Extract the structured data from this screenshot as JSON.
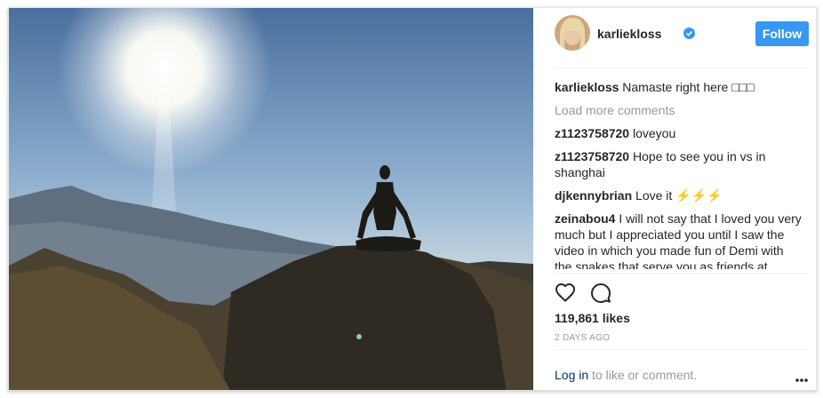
{
  "post": {
    "username": "karliekloss",
    "follow_label": "Follow",
    "caption": {
      "user": "karliekloss",
      "text": "Namaste right here □□□"
    },
    "load_more": "Load more comments",
    "comments": [
      {
        "user": "z1123758720",
        "text": "loveyou"
      },
      {
        "user": "z1123758720",
        "text": "Hope to see you in vs in shanghai"
      },
      {
        "user": "djkennybrian",
        "text": "Love it ⚡⚡⚡"
      },
      {
        "user": "zeinabou4",
        "text": "I will not say that I loved you very much but I appreciated you until I saw the video in which you made fun of Demi with the snakes that serve you as friends at"
      }
    ],
    "likes": "119,861 likes",
    "timestamp": "2 DAYS AGO",
    "login_link": "Log in",
    "login_suffix": " to like or comment."
  },
  "icons": {
    "verified": "verified-badge-icon",
    "like": "heart-icon",
    "comment": "comment-icon",
    "more": "more-options-icon"
  },
  "colors": {
    "accent": "#3897f0",
    "link": "#003569",
    "muted": "#999999",
    "text": "#262626"
  }
}
